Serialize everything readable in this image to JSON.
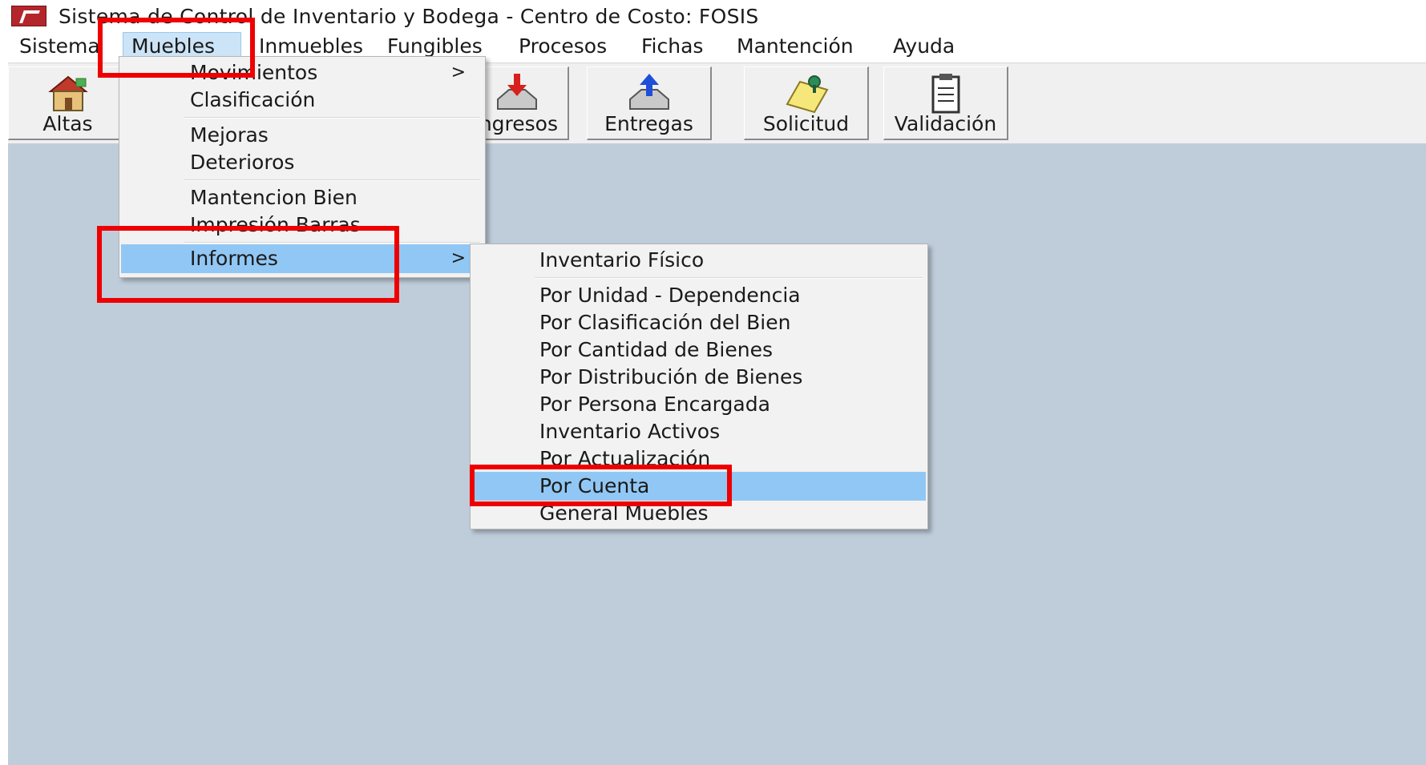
{
  "window": {
    "title": "Sistema de Control de Inventario y Bodega - Centro de Costo: FOSIS"
  },
  "menubar": {
    "items": [
      "Sistema",
      "Muebles",
      "Inmuebles",
      "Fungibles",
      "Procesos",
      "Fichas",
      "Mantención",
      "Ayuda"
    ]
  },
  "toolbar": {
    "buttons": [
      "Altas",
      "Ingresos",
      "Entregas",
      "Solicitud",
      "Validación"
    ]
  },
  "muebles_menu": {
    "items": [
      {
        "label": "Movimientos",
        "arrow": ">"
      },
      {
        "label": "Clasificación"
      },
      {
        "label": "Mejoras"
      },
      {
        "label": "Deterioros"
      },
      {
        "label": "Mantencion Bien"
      },
      {
        "label": "Impresión Barras"
      },
      {
        "label": "Informes",
        "arrow": ">"
      }
    ]
  },
  "informes_menu": {
    "items": [
      "Inventario Físico",
      "Por Unidad - Dependencia",
      "Por Clasificación del Bien",
      "Por Cantidad de Bienes",
      "Por Distribución de Bienes",
      "Por Persona Encargada",
      "Inventario Activos",
      "Por Actualización",
      "Por Cuenta",
      "General Muebles"
    ]
  },
  "colors": {
    "workspace": "#bfcddb",
    "menu_highlight": "#91c7f4",
    "annotation_red": "#ee0000"
  }
}
